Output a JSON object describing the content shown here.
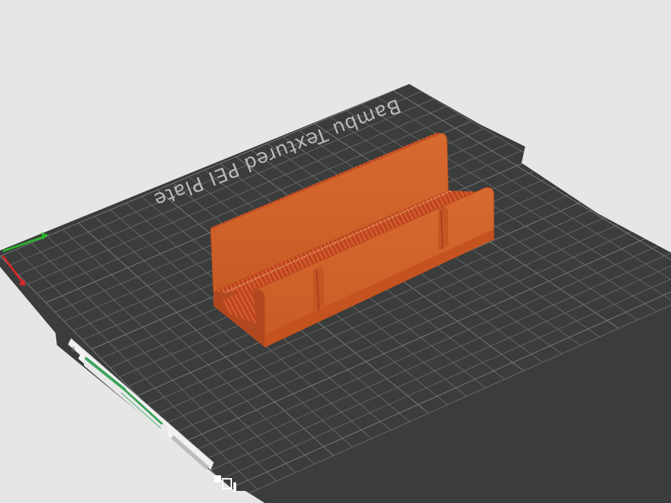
{
  "viewport": {
    "plate_label": "Bambu Textured PEI Plate",
    "colors": {
      "background": "#e6e6e6",
      "plate": "#3b3c3c",
      "grid": "#6a6a6a",
      "model": "#d5622a",
      "model_side": "#a8401e",
      "model_edge": "#e8803c",
      "axis_x": "#d42a2a",
      "axis_y": "#2ab52a",
      "thumbnail_bg": "#f0f0f0",
      "thumbnail_bar": "#3aa35a"
    }
  },
  "objects": [
    {
      "name": "card-holder",
      "type": "3d-model"
    }
  ],
  "axes": [
    "x-axis",
    "y-axis"
  ],
  "plate_controls": [
    {
      "icon": "lock-icon"
    },
    {
      "icon": "reset-view-icon"
    },
    {
      "icon": "settings-icon"
    }
  ]
}
